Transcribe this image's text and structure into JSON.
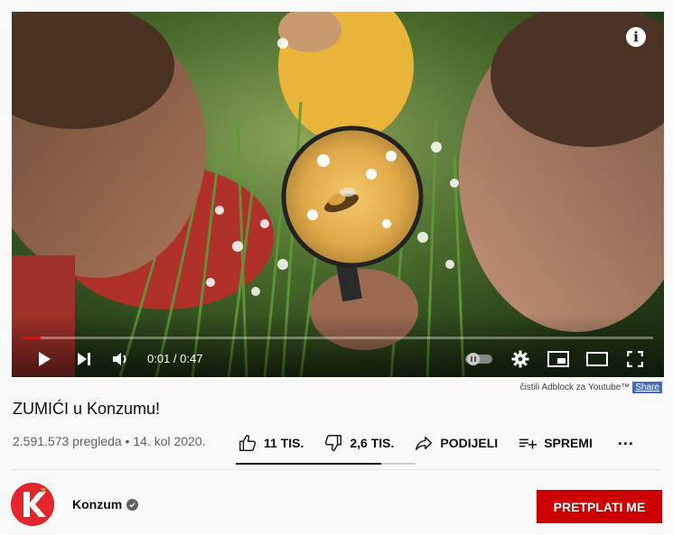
{
  "player": {
    "time_current": "0:01",
    "time_separator": " / ",
    "time_total": "0:47",
    "progress_fraction": 0.028,
    "info_label": "i",
    "icons": [
      "info-icon",
      "play-icon",
      "next-icon",
      "volume-icon",
      "autoplay-toggle-icon",
      "settings-gear-icon",
      "miniplayer-icon",
      "theater-mode-icon",
      "fullscreen-icon"
    ]
  },
  "extension": {
    "text": "čistili Adblock za Youtube™",
    "share_label": "Share"
  },
  "video": {
    "title": "ZUMIĆI u Konzumu!",
    "views": "2.591.573 pregleda",
    "separator": " • ",
    "date": "14. kol 2020."
  },
  "actions": {
    "like_count": "11 TIS.",
    "dislike_count": "2,6 TIS.",
    "share_label": "PODIJELI",
    "save_label": "SPREMI",
    "more_label": "...",
    "like_ratio": 0.81
  },
  "channel": {
    "name": "Konzum",
    "subscribe_label": "PRETPLATI ME",
    "brand_color": "#e3262b",
    "accent_color": "#6bbf3a"
  },
  "colors": {
    "progress": "#ff0000",
    "subscribe": "#cc0000",
    "share_chip": "#4a6cba"
  }
}
